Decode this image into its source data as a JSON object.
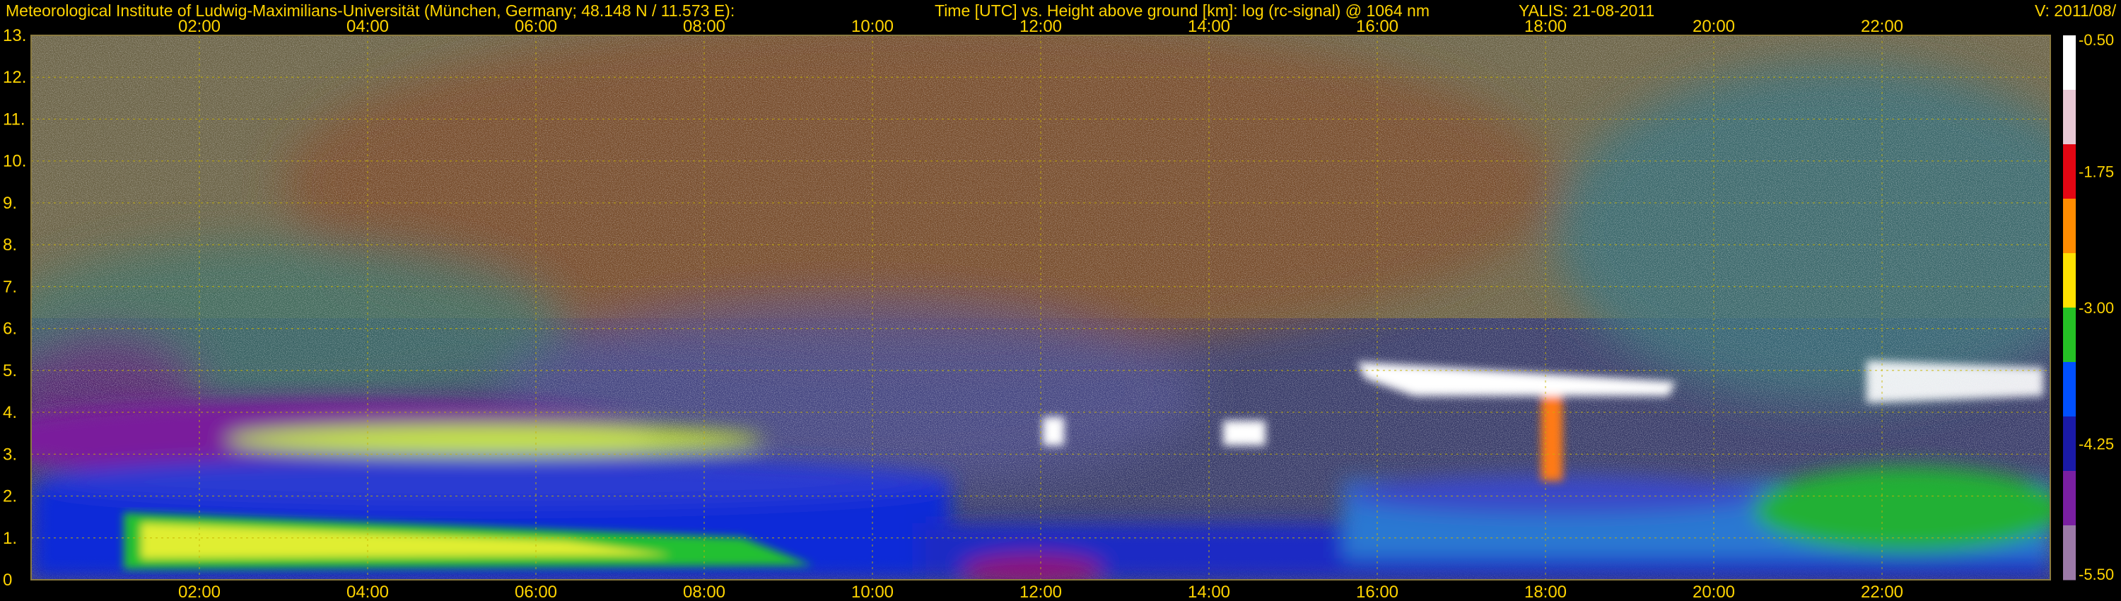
{
  "header": {
    "institute": "Meteorological Institute of Ludwig-Maximilians-Universität (München, Germany; 48.148 N / 11.573 E):",
    "plot_desc": "Time [UTC] vs. Height above ground [km]: log (rc-signal) @ 1064 nm",
    "system_date": "YALIS: 21-08-2011",
    "version": "V: 2011/08/"
  },
  "chart_data": {
    "type": "heatmap",
    "title": "Time [UTC] vs. Height above ground [km]: log (rc-signal) @ 1064 nm",
    "x": {
      "unit": "UTC",
      "range": [
        "00:00",
        "24:00"
      ],
      "tick_labels": [
        "02:00",
        "04:00",
        "06:00",
        "08:00",
        "10:00",
        "12:00",
        "14:00",
        "16:00",
        "18:00",
        "20:00",
        "22:00"
      ]
    },
    "y": {
      "unit": "km",
      "range": [
        0,
        13
      ],
      "tick_labels": [
        "0",
        "1.",
        "2.",
        "3.",
        "4.",
        "5.",
        "6.",
        "7.",
        "8.",
        "9.",
        "10.",
        "11.",
        "12.",
        "13."
      ]
    },
    "colorbar": {
      "range": [
        -5.5,
        -0.5
      ],
      "tick_labels": [
        "-0.50",
        "-1.75",
        "-3.00",
        "-4.25",
        "-5.50"
      ],
      "palette": [
        "#ffffff",
        "#e8c8d4",
        "#e30613",
        "#ff8c00",
        "#ffe100",
        "#25c125",
        "#0050ff",
        "#1a1aa8",
        "#7a1fa2",
        "#9c7aa8"
      ]
    },
    "features": [
      {
        "label": "boundary layer (aerosol)",
        "start": "01:00",
        "end": "09:30",
        "height_km": [
          0.3,
          1.7
        ]
      },
      {
        "label": "elevated aerosol layer",
        "start": "02:30",
        "end": "11:00",
        "height_km": [
          2.9,
          3.7
        ]
      },
      {
        "label": "cloud",
        "start": "12:00",
        "end": "12:20",
        "height_km": [
          3.3,
          3.6
        ]
      },
      {
        "label": "cloud",
        "start": "14:10",
        "end": "14:40",
        "height_km": [
          3.3,
          3.6
        ]
      },
      {
        "label": "cloud layer",
        "start": "16:00",
        "end": "19:40",
        "height_km": [
          4.4,
          5.1
        ]
      },
      {
        "label": "cloud layer",
        "start": "21:40",
        "end": "23:50",
        "height_km": [
          4.3,
          5.1
        ]
      }
    ]
  }
}
